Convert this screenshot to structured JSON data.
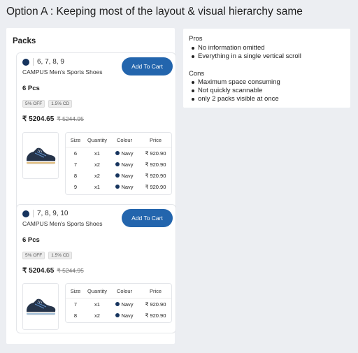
{
  "heading": "Option A : Keeping most of the layout & visual hierarchy same",
  "panel": {
    "title": "Packs",
    "packs": [
      {
        "sizes": "6, 7, 8, 9",
        "product": "CAMPUS Men's Sports Shoes",
        "button": "Add To Cart",
        "pcs": "6 Pcs",
        "badges": [
          "5% OFF",
          "1.5% CD"
        ],
        "price": "₹ 5204.65",
        "mrp": "₹ 5244.95",
        "table": {
          "headers": [
            "Size",
            "Quantity",
            "Colour",
            "Price"
          ],
          "rows": [
            {
              "size": "6",
              "qty": "x1",
              "colour": "Navy",
              "price": "₹ 920.90"
            },
            {
              "size": "7",
              "qty": "x2",
              "colour": "Navy",
              "price": "₹ 920.90"
            },
            {
              "size": "8",
              "qty": "x2",
              "colour": "Navy",
              "price": "₹ 920.90"
            },
            {
              "size": "9",
              "qty": "x1",
              "colour": "Navy",
              "price": "₹ 920.90"
            }
          ]
        }
      },
      {
        "sizes": "7, 8, 9, 10",
        "product": "CAMPUS Men's Sports Shoes",
        "button": "Add To Cart",
        "pcs": "6 Pcs",
        "badges": [
          "5% OFF",
          "1.5% CD"
        ],
        "price": "₹ 5204.65",
        "mrp": "₹ 5244.95",
        "table": {
          "headers": [
            "Size",
            "Quantity",
            "Colour",
            "Price"
          ],
          "rows": [
            {
              "size": "7",
              "qty": "x1",
              "colour": "Navy",
              "price": "₹ 920.90"
            },
            {
              "size": "8",
              "qty": "x2",
              "colour": "Navy",
              "price": "₹ 920.90"
            }
          ]
        }
      }
    ]
  },
  "notes": {
    "pros_title": "Pros",
    "pros": [
      "No information omitted",
      "Everything in a single vertical scroll"
    ],
    "cons_title": "Cons",
    "cons": [
      "Maximum space consuming",
      "Not quickly scannable",
      "only 2 packs visible at once"
    ]
  },
  "colors": {
    "accent": "#2365ad",
    "navy": "#16345e",
    "background": "#eceef2"
  }
}
